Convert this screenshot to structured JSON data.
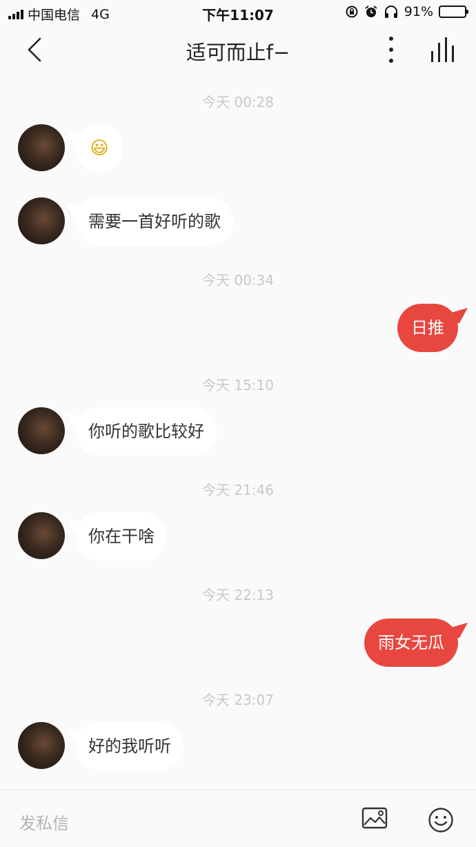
{
  "status": {
    "carrier": "中国电信",
    "network": "4G",
    "time": "下午11:07",
    "battery": "91%",
    "battery_level": 0.91
  },
  "header": {
    "title": "适可而止f−"
  },
  "messages": {
    "ts1": "今天 00:28",
    "m1": "😃",
    "m2": "需要一首好听的歌",
    "ts2": "今天 00:34",
    "m3": "日推",
    "ts3": "今天 15:10",
    "m4": "你听的歌比较好",
    "ts4": "今天 21:46",
    "m5": "你在干啥",
    "ts5": "今天 22:13",
    "m6": "雨女无瓜",
    "ts6": "今天 23:07",
    "m7": "好的我听听"
  },
  "composer": {
    "placeholder": "发私信"
  },
  "colors": {
    "accent": "#e8473f",
    "background": "#fafafa",
    "timestamp": "#c8c8c8"
  },
  "icons": [
    "back-icon",
    "more-icon",
    "equalizer-icon",
    "image-icon",
    "emoji-icon"
  ]
}
